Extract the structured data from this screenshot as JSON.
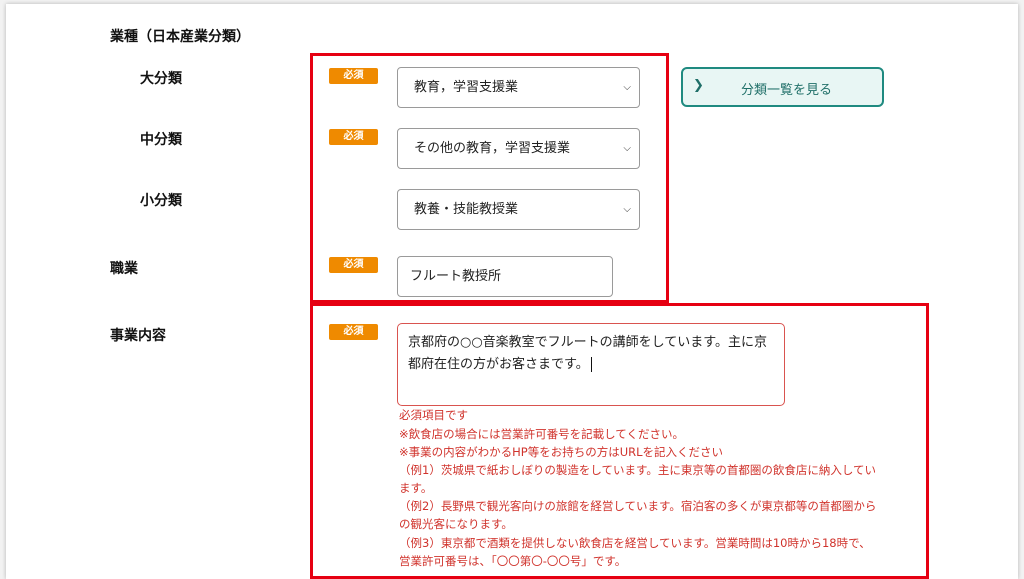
{
  "industry": {
    "heading": "業種（日本産業分類）",
    "major": {
      "label": "大分類",
      "badge": "必須",
      "value": "教育，学習支援業"
    },
    "middle": {
      "label": "中分類",
      "badge": "必須",
      "value": "その他の教育，学習支援業"
    },
    "minor": {
      "label": "小分類",
      "value": "教養・技能教授業"
    },
    "list_button": "分類一覧を見る"
  },
  "occupation": {
    "label": "職業",
    "badge": "必須",
    "value": "フルート教授所"
  },
  "business": {
    "label": "事業内容",
    "badge": "必須",
    "lines": [
      "京都府の○○音楽教室でフルートの講師をしています。主に京",
      "都府在住の方がお客さまです。"
    ],
    "notes": [
      "必須項目です",
      "※飲食店の場合には営業許可番号を記載してください。",
      "※事業の内容がわかるHP等をお持ちの方はURLを記入ください",
      "（例1）茨城県で紙おしぼりの製造をしています。主に東京等の首都圏の飲食店に納入してい",
      "ます。",
      "（例2）長野県で観光客向けの旅館を経営しています。宿泊客の多くが東京都等の首都圏から",
      "の観光客になります。",
      "（例3）東京都で酒類を提供しない飲食店を経営しています。営業時間は10時から18時で、",
      "営業許可番号は、「〇〇第〇-〇〇号」です。"
    ]
  },
  "colors": {
    "badge": "#ef8a00",
    "highlight": "#e60012",
    "error_text": "#d0332c",
    "button_border": "#1f8a80"
  },
  "icons": {
    "select_arrow": "chevron-down-icon",
    "button_arrow": "chevron-right-icon"
  }
}
